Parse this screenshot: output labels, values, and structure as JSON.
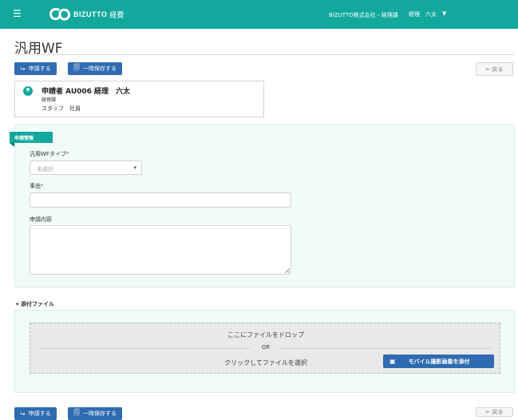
{
  "header": {
    "menu_icon": "☰",
    "logo_text": "BIZUTTO",
    "logo_jp": "経費",
    "company": "BIZUTTO株式会社・経理課",
    "user_name": "経理　六太",
    "user_caret": "▼",
    "brand_color": "#13a89e"
  },
  "page": {
    "title": "汎用WF"
  },
  "toolbar": {
    "apply_icon": "↪",
    "apply_label": "申請する",
    "save_icon": "🗐",
    "save_label": "一時保存する",
    "back_label": "← 戻る"
  },
  "applicant": {
    "name_line": "申請者 AU006 経理　六太",
    "department": "経理課",
    "role": "スタッフ　社員"
  },
  "application_info": {
    "section_tag": "申請情報",
    "wf_type_label": "汎用WFタイプ",
    "required_mark": "*",
    "wf_type_placeholder": "未選択",
    "select_arrow": "▾",
    "reason_label": "事由",
    "content_label": "申請内容"
  },
  "attachments": {
    "toggle_label": "▾ 添付ファイル",
    "drop_text": "ここにファイルをドロップ",
    "or_text": "OR",
    "click_text": "クリックしてファイルを選択",
    "mobile_icon": "▣",
    "mobile_button_label": "モバイル撮影画像を添付"
  }
}
